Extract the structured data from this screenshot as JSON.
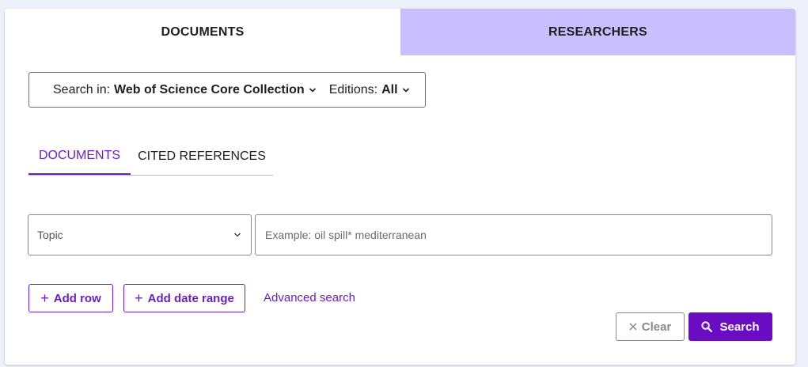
{
  "top_tabs": {
    "documents": "DOCUMENTS",
    "researchers": "RESEARCHERS"
  },
  "scope": {
    "search_in_label": "Search in:",
    "search_in_value": "Web of Science Core Collection",
    "editions_label": "Editions:",
    "editions_value": "All"
  },
  "sub_tabs": {
    "documents": "DOCUMENTS",
    "cited_references": "CITED REFERENCES"
  },
  "query": {
    "field": "Topic",
    "placeholder": "Example: oil spill* mediterranean",
    "value": ""
  },
  "actions": {
    "add_row": "Add row",
    "add_date_range": "Add date range",
    "advanced_search": "Advanced search",
    "clear": "Clear",
    "search": "Search"
  },
  "colors": {
    "accent": "#6a1fbf",
    "search_button": "#6a0dc2",
    "inactive_tab": "#c9beff",
    "background": "#eef0fa"
  },
  "icons": [
    "chevron-down-icon",
    "plus-icon",
    "close-icon",
    "search-icon"
  ]
}
